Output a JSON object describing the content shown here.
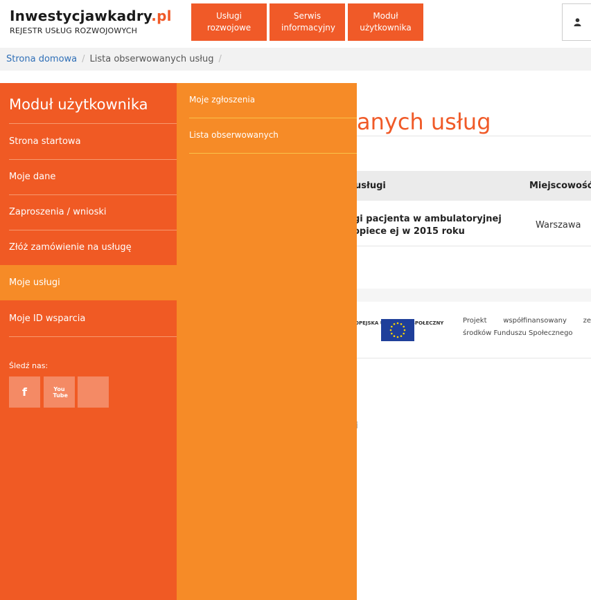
{
  "header": {
    "logo_main": "Inwestycjawkadry",
    "logo_accent": ".pl",
    "logo_sub": "REJESTR USŁUG ROZWOJOWYCH",
    "nav": [
      {
        "label": "Usługi rozwojowe"
      },
      {
        "label": "Serwis informacyjny"
      },
      {
        "label": "Moduł użytkownika"
      }
    ],
    "user_icon": "user-icon"
  },
  "breadcrumb": {
    "home": "Strona domowa",
    "current": "Lista obserwowanych usług",
    "separator": "/"
  },
  "page": {
    "title_visible": "anych usług",
    "table": {
      "col_name": "usługi",
      "col_city": "Miejscowość",
      "row_name": "gi pacjenta w ambulatoryjnej opiece ej w 2015 roku",
      "row_city": "Warszawa"
    },
    "ue_text": "OPEJSKA UROPEJSKI SPOŁECZNY",
    "funding_note": "Projekt współfinansowany ze środków Funduszu Społecznego",
    "stray_text": "i"
  },
  "sidebar": {
    "title": "Moduł użytkownika",
    "items": [
      {
        "label": "Strona startowa",
        "active": false
      },
      {
        "label": "Moje dane",
        "active": false
      },
      {
        "label": "Zaproszenia / wnioski",
        "active": false
      },
      {
        "label": "Złóż zamówienie na usługę",
        "active": false
      },
      {
        "label": "Moje usługi",
        "active": true
      },
      {
        "label": "Moje ID wsparcia",
        "active": false
      }
    ],
    "follow_label": "Śledź nas:",
    "social": [
      {
        "icon": "facebook-icon",
        "glyph": "f"
      },
      {
        "icon": "youtube-icon",
        "glyph": "You Tube"
      },
      {
        "icon": "social-blank-icon",
        "glyph": ""
      }
    ]
  },
  "submenu": {
    "items": [
      {
        "label": "Moje zgłoszenia"
      },
      {
        "label": "Lista obserwowanych"
      }
    ]
  },
  "colors": {
    "brand_orange": "#f05a24",
    "submenu_orange": "#f68b27",
    "link_blue": "#2f6fb7",
    "eu_blue": "#1f3f9a"
  }
}
